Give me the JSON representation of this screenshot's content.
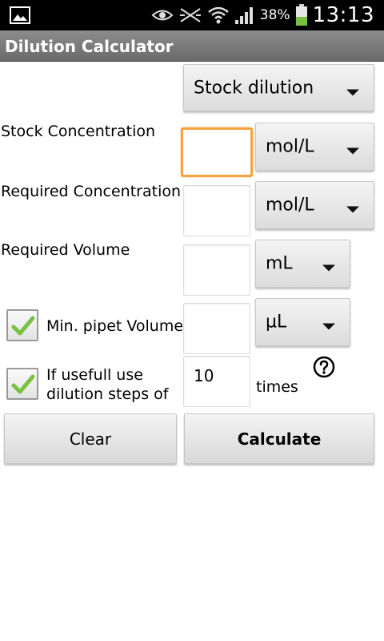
{
  "status_bar": {
    "battery_percent": "38%",
    "time": "13:13",
    "icons": [
      "image-icon",
      "eye-icon",
      "no-signal-icon",
      "wifi-icon",
      "signal-icon",
      "battery-icon"
    ]
  },
  "app": {
    "title": "Dilution Calculator"
  },
  "mode_spinner": {
    "value": "Stock dilution"
  },
  "rows": {
    "stock": {
      "label": "Stock Concentration",
      "value": "",
      "unit": "mol/L"
    },
    "required_conc": {
      "label": "Required Concentration",
      "value": "",
      "unit": "mol/L"
    },
    "required_vol": {
      "label": "Required Volume",
      "value": "",
      "unit": "mL"
    },
    "min_pipet": {
      "label": "Min. pipet Volume",
      "checked": true,
      "value": "",
      "unit": "µL"
    },
    "dilution_steps": {
      "label_line1": "If usefull use",
      "label_line2": "dilution steps of",
      "checked": true,
      "value": "10",
      "suffix": "times"
    }
  },
  "buttons": {
    "clear": "Clear",
    "calculate": "Calculate"
  },
  "colors": {
    "focus": "#f5a341",
    "check": "#7ac143",
    "title_bar": "#7a7a7a"
  }
}
